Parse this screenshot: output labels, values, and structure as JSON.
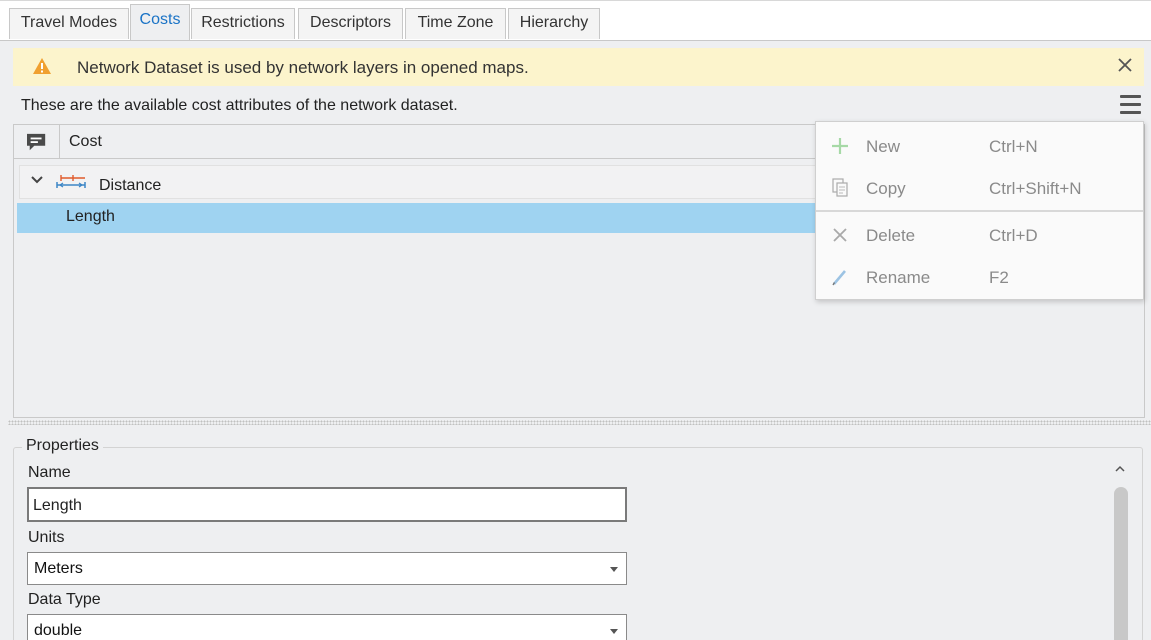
{
  "tabs": [
    {
      "label": "Travel Modes",
      "active": false
    },
    {
      "label": "Costs",
      "active": true
    },
    {
      "label": "Restrictions",
      "active": false
    },
    {
      "label": "Descriptors",
      "active": false
    },
    {
      "label": "Time Zone",
      "active": false
    },
    {
      "label": "Hierarchy",
      "active": false
    }
  ],
  "banner": {
    "message": "Network Dataset is used by network layers in opened maps.",
    "icon": "warning-icon",
    "color": "#fcf4cc"
  },
  "description": "These are the available cost attributes of the network dataset.",
  "grid": {
    "column_header": "Cost",
    "group": {
      "label": "Distance",
      "expanded": true
    },
    "rows": [
      {
        "label": "Length",
        "selected": true
      }
    ]
  },
  "context_menu": {
    "items": [
      {
        "label": "New",
        "shortcut": "Ctrl+N",
        "icon": "plus-icon",
        "enabled": false
      },
      {
        "label": "Copy",
        "shortcut": "Ctrl+Shift+N",
        "icon": "copy-icon",
        "enabled": false
      },
      {
        "label": "Delete",
        "shortcut": "Ctrl+D",
        "icon": "delete-icon",
        "enabled": false
      },
      {
        "label": "Rename",
        "shortcut": "F2",
        "icon": "pencil-icon",
        "enabled": false
      }
    ]
  },
  "properties": {
    "title": "Properties",
    "name_label": "Name",
    "name_value": "Length",
    "units_label": "Units",
    "units_value": "Meters",
    "datatype_label": "Data Type",
    "datatype_value": "double"
  },
  "colors": {
    "accent": "#1a73c6",
    "selection": "#9fd3f1",
    "warning": "#f0a030"
  }
}
